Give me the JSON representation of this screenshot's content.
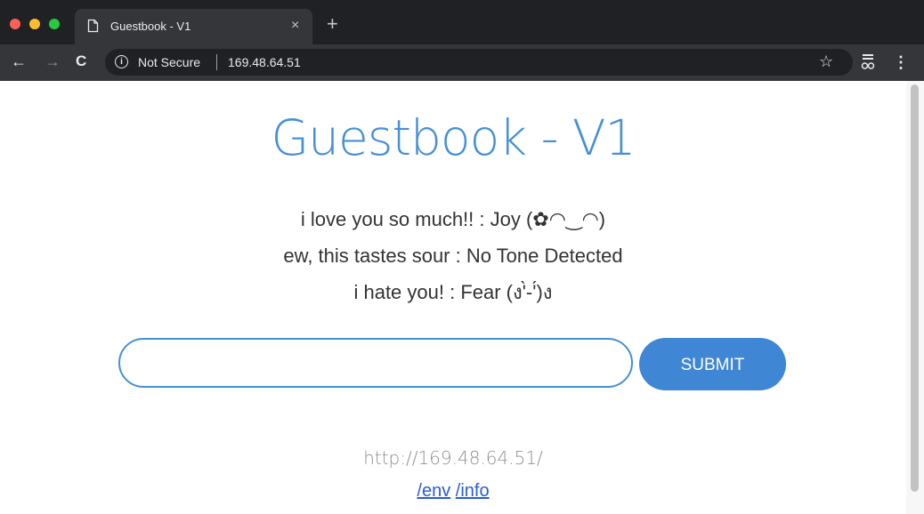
{
  "browser": {
    "tab": {
      "title": "Guestbook - V1",
      "close_glyph": "×"
    },
    "new_tab_glyph": "+",
    "toolbar": {
      "back_glyph": "←",
      "forward_glyph": "→",
      "reload_glyph": "C",
      "security_label": "Not Secure",
      "url": "169.48.64.51",
      "star_glyph": "☆",
      "menu_glyph": "⋮"
    },
    "colors": {
      "tabstrip": "#202124",
      "toolbar": "#35363a",
      "accent": "#4590d6"
    }
  },
  "page": {
    "title": "Guestbook - V1",
    "entries": [
      {
        "text": "i love you so much!! : Joy (✿◠‿◠)"
      },
      {
        "text": "ew, this tastes sour : No Tone Detected"
      },
      {
        "text": "i hate you! : Fear (ง'̀-'́)ง"
      }
    ],
    "form": {
      "input_value": "",
      "input_placeholder": "",
      "submit_label": "SUBMIT"
    },
    "footer": {
      "host": "http://169.48.64.51/",
      "links": [
        {
          "label": "/env"
        },
        {
          "label": "/info"
        }
      ]
    }
  }
}
